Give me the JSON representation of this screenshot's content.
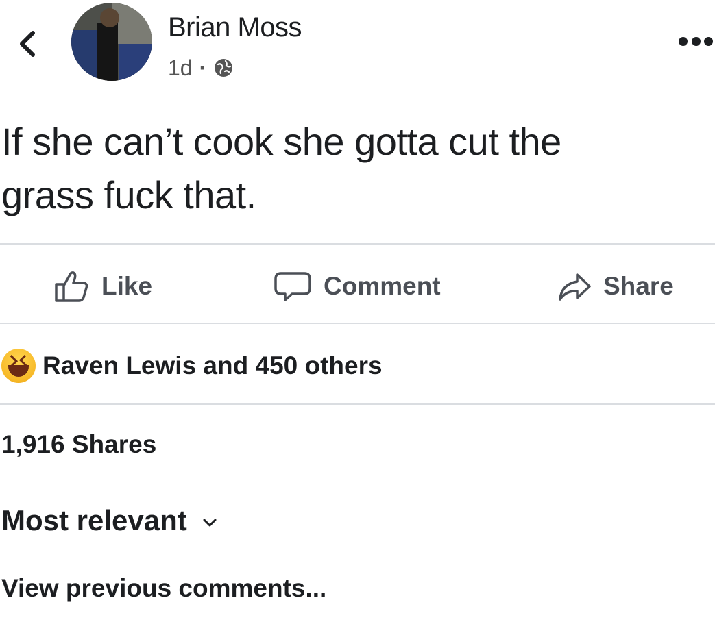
{
  "header": {
    "back_icon": "chevron-left-icon",
    "author_name": "Brian Moss",
    "time_ago": "1d",
    "separator": "·",
    "privacy_icon": "globe-icon",
    "more_icon": "ellipsis-icon"
  },
  "post": {
    "text": "If she can’t cook she gotta cut the\ngrass fuck that."
  },
  "actions": {
    "like_label": "Like",
    "comment_label": "Comment",
    "share_label": "Share"
  },
  "reactions": {
    "emoji_icon": "haha-emoji-icon",
    "summary": "Raven Lewis and 450 others"
  },
  "shares": {
    "text": "1,916 Shares"
  },
  "comments": {
    "sort_label": "Most relevant",
    "view_previous": "View previous comments..."
  },
  "colors": {
    "text_primary": "#1c1e21",
    "text_secondary": "#4b4f56",
    "divider": "#dadde1",
    "reaction_yellow": "#f7b928"
  }
}
